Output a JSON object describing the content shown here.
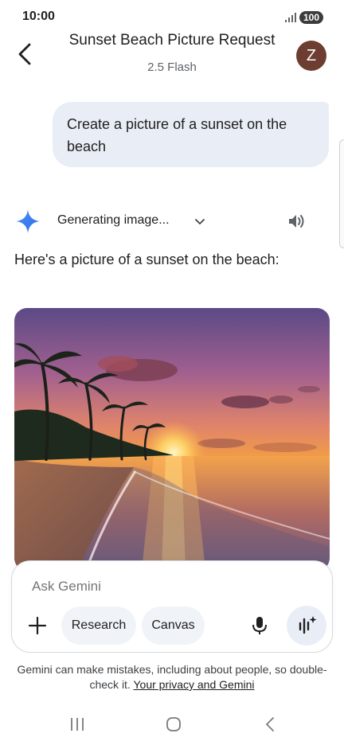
{
  "status_bar": {
    "time": "10:00",
    "battery": "100",
    "icons": [
      "signal-icon",
      "battery-icon"
    ]
  },
  "header": {
    "title": "Sunset Beach Picture Request",
    "model": "2.5 Flash",
    "avatar_initial": "Z",
    "avatar_color": "#6d3d31",
    "icons": [
      "back-arrow-icon"
    ]
  },
  "conversation": {
    "user_message": "Create a picture of a sunset on the beach",
    "response": {
      "status": "Generating image...",
      "text": "Here's a picture of a sunset on the beach:",
      "icons": [
        "gemini-spark-icon",
        "chevron-down-icon",
        "speaker-icon"
      ]
    }
  },
  "composer": {
    "placeholder": "Ask Gemini",
    "chips": [
      {
        "label": "Research"
      },
      {
        "label": "Canvas"
      }
    ],
    "icons": [
      "plus-icon",
      "microphone-icon",
      "live-icon"
    ]
  },
  "disclaimer": {
    "text": "Gemini can make mistakes, including about people, so double-check it. ",
    "link": "Your privacy and Gemini"
  },
  "nav_bar": {
    "icons": [
      "recents-icon",
      "home-icon",
      "back-icon"
    ]
  },
  "colors": {
    "bubble": "#e9eef6",
    "chip": "#f0f4f9",
    "accent_blue": "#4285f4"
  }
}
